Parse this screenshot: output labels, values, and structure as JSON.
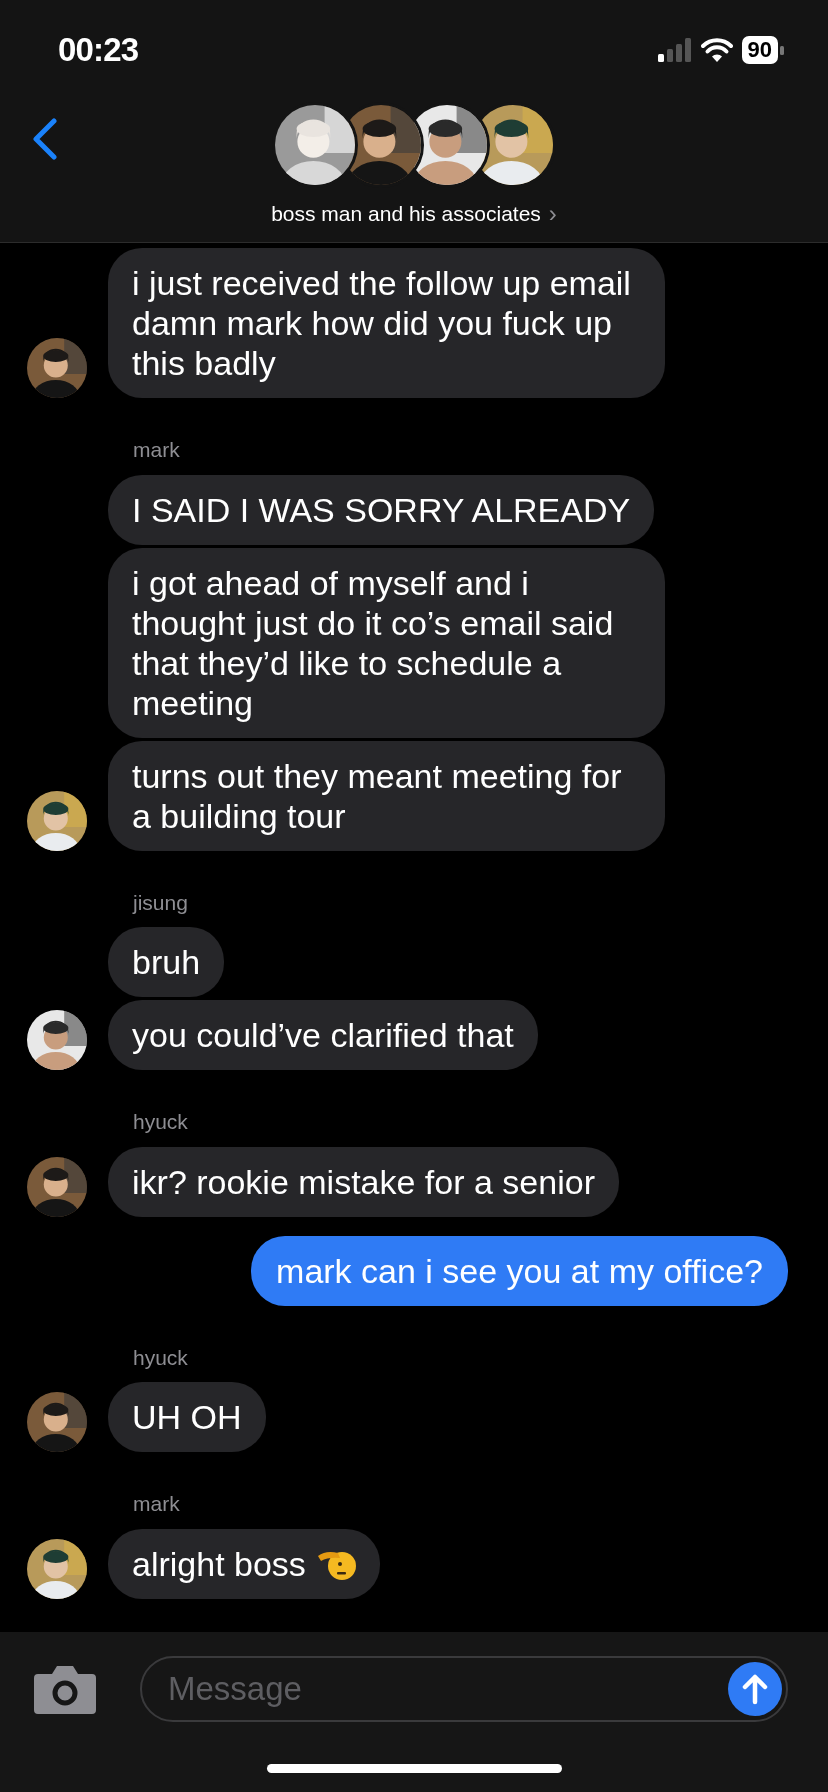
{
  "status_bar": {
    "time": "00:23",
    "battery": "90"
  },
  "header": {
    "title": "boss man and his associates",
    "chevron": "›",
    "avatars": [
      {
        "kind": "picture"
      },
      {
        "kind": "picture"
      },
      {
        "kind": "picture"
      },
      {
        "kind": "picture"
      }
    ]
  },
  "groups": [
    {
      "outgoing": false,
      "avatar": {
        "kind": "picture"
      },
      "messages": [
        {
          "text": "i just received the follow up email damn mark how did you fuck up this badly"
        }
      ]
    },
    {
      "outgoing": false,
      "sender": "mark",
      "avatar": {
        "kind": "picture"
      },
      "messages": [
        {
          "text": "I SAID I WAS SORRY ALREADY"
        },
        {
          "text": "i got ahead of myself and i thought just do it co’s email said that they’d like to schedule a meeting"
        },
        {
          "text": "turns out they meant meeting for a building tour"
        }
      ]
    },
    {
      "outgoing": false,
      "sender": "jisung",
      "avatar": {
        "kind": "picture"
      },
      "messages": [
        {
          "text": "bruh"
        },
        {
          "text": "you could’ve clarified that"
        }
      ]
    },
    {
      "outgoing": false,
      "sender": "hyuck",
      "avatar": {
        "kind": "picture"
      },
      "messages": [
        {
          "text": "ikr? rookie mistake for a senior"
        }
      ]
    },
    {
      "outgoing": true,
      "messages": [
        {
          "text": "mark can i see you at my office?"
        }
      ]
    },
    {
      "outgoing": false,
      "sender": "hyuck",
      "avatar": {
        "kind": "picture"
      },
      "messages": [
        {
          "text": "UH OH"
        }
      ]
    },
    {
      "outgoing": false,
      "sender": "mark",
      "avatar": {
        "kind": "picture"
      },
      "messages": [
        {
          "text": "alright boss",
          "kind": "with_salute_emoji"
        }
      ]
    }
  ],
  "composer": {
    "placeholder": "Message"
  }
}
